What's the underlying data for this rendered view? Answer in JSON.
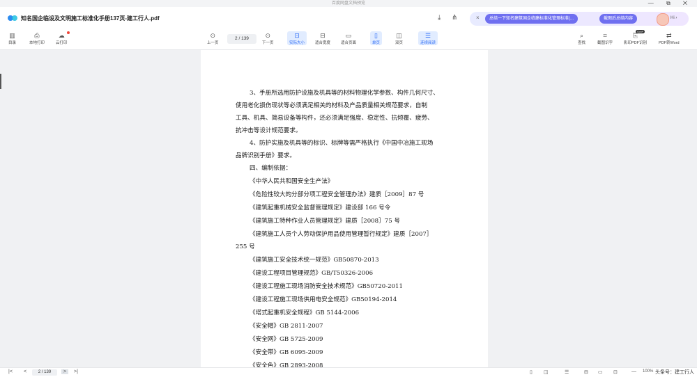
{
  "window": {
    "title": "百度网盘文档预览",
    "controls": "— ⧉ ✕"
  },
  "header": {
    "doc_title": "知名国企临设及文明施工标准化手册137页-建工行人.pdf",
    "ai": {
      "close": "×",
      "summary_label": "总结一下知名建筑国企临建标准化管理标准(...",
      "summary_button": "截图后总结内容",
      "greeting": "Hi ›"
    }
  },
  "toolbar": {
    "left": [
      {
        "icon": "sidebar-icon",
        "glyph": "▥",
        "label": "目录"
      },
      {
        "icon": "printer-icon",
        "glyph": "⎙",
        "label": "本地打印"
      },
      {
        "icon": "cloud-print-icon",
        "glyph": "☁",
        "label": "云打印"
      }
    ],
    "prev_label": "上一页",
    "next_label": "下一页",
    "page_current": "2",
    "page_total": "/ 139",
    "page_display": "2  /  139",
    "center": [
      {
        "icon": "actual-size-icon",
        "glyph": "⊡",
        "label": "实际大小",
        "active": true
      },
      {
        "icon": "fit-width-icon",
        "glyph": "⊟",
        "label": "适合宽度",
        "active": false
      },
      {
        "icon": "fit-page-icon",
        "glyph": "▭",
        "label": "适合页面",
        "active": false
      },
      {
        "icon": "single-page-icon",
        "glyph": "▯",
        "label": "单页",
        "active": true
      },
      {
        "icon": "double-page-icon",
        "glyph": "◫",
        "label": "双页",
        "active": false
      },
      {
        "icon": "continuous-icon",
        "glyph": "☰",
        "label": "连续阅读",
        "active": true
      }
    ],
    "right": [
      {
        "icon": "search-icon",
        "glyph": "⌕",
        "label": "查找"
      },
      {
        "icon": "screenshot-ocr-icon",
        "glyph": "⌗",
        "label": "截图识字"
      },
      {
        "icon": "ocr-pdf-icon",
        "glyph": "⎘",
        "label": "影印PDF识别"
      },
      {
        "icon": "pdf-to-word-icon",
        "glyph": "⇄",
        "label": "PDF转Word"
      }
    ],
    "new_badge": "SVIP"
  },
  "document": {
    "lines": [
      "3、手册所选用防护设施及机具等的材料物理化学参数、构件几何尺寸、",
      "使用老化损伤现状等必须满足相关的材料及产品质量相关规范要求，自制",
      "工具、机具、简易设备等构件，还必须满足强度、稳定性、抗倾覆、疲劳、",
      "抗冲击等设计规范要求。",
      "4、防护实施及机具等的标识、标牌等需严格执行《中国中冶施工现场",
      "品牌识别手册》要求。",
      "四、编制依据：",
      "《中华人民共和国安全生产法》",
      "《危险性较大的分部分项工程安全管理办法》建质［2009］87 号",
      "《建筑起重机械安全监督管理规定》建设部 166 号令",
      "《建筑施工特种作业人员管理规定》建质［2008］75 号",
      "《建筑施工人员个人劳动保护用品使用管理暂行规定》建质［2007］",
      "255 号",
      "《建筑施工安全技术统一规范》GB50870-2013",
      "《建设工程项目管理规范》GB/T50326-2006",
      "《建设工程施工现场消防安全技术规范》GB50720-2011",
      "《建设工程施工现场供用电安全规范》GB50194-2014",
      "《塔式起重机安全规程》GB 5144-2006",
      "《安全帽》GB 2811-2007",
      "《安全网》GB 5725-2009",
      "《安全带》GB 6095-2009",
      "《安全色》GB 2893-2008"
    ]
  },
  "statusbar": {
    "first": "|<",
    "prev": "<",
    "page": "2 / 139",
    "next": ">",
    "last": ">|",
    "zoom": "100%",
    "watermark": "头条号：建工行人"
  },
  "colors": {
    "accent": "#2d6cf6",
    "ai_pill": "#6f6ff0",
    "notify": "#f04438"
  }
}
